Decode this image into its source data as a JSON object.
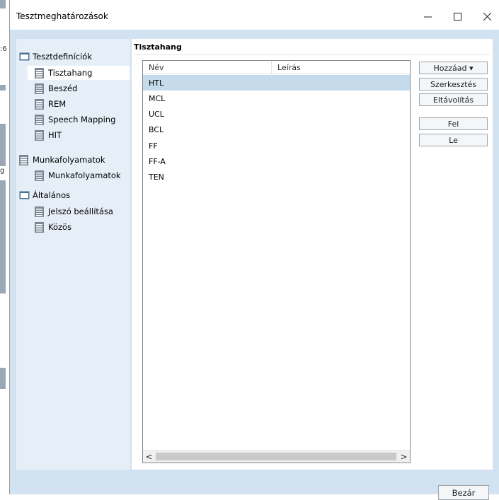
{
  "window": {
    "title": "Tesztmeghatározások",
    "controls": {
      "minimize": "minimize-icon",
      "maximize": "maximize-icon",
      "close": "close-icon"
    }
  },
  "background_fragments": [
    ":6",
    "g"
  ],
  "sidebar": {
    "items": [
      {
        "label": "Tesztdefiníciók",
        "icon": "folder-icon",
        "level": 0
      },
      {
        "label": "Tisztahang",
        "icon": "page-icon",
        "level": 1,
        "selected": true
      },
      {
        "label": "Beszéd",
        "icon": "page-icon",
        "level": 1
      },
      {
        "label": "REM",
        "icon": "page-icon",
        "level": 1
      },
      {
        "label": "Speech Mapping",
        "icon": "page-icon",
        "level": 1
      },
      {
        "label": "HIT",
        "icon": "page-icon",
        "level": 1
      },
      {
        "label": "Munkafolyamatok",
        "icon": "page-icon",
        "level": 0
      },
      {
        "label": "Munkafolyamatok",
        "icon": "page-icon",
        "level": 1
      },
      {
        "label": "Általános",
        "icon": "folder-icon",
        "level": 0
      },
      {
        "label": "Jelszó beállítása",
        "icon": "page-icon",
        "level": 1
      },
      {
        "label": "Közös",
        "icon": "page-icon",
        "level": 1
      }
    ]
  },
  "main": {
    "section_title": "Tisztahang",
    "table": {
      "columns": [
        "Név",
        "Leírás"
      ],
      "rows": [
        {
          "name": "HTL",
          "description": "",
          "selected": true
        },
        {
          "name": "MCL",
          "description": ""
        },
        {
          "name": "UCL",
          "description": ""
        },
        {
          "name": "BCL",
          "description": ""
        },
        {
          "name": "FF",
          "description": ""
        },
        {
          "name": "FF-A",
          "description": ""
        },
        {
          "name": "TEN",
          "description": ""
        }
      ],
      "scroll_left": "<",
      "scroll_right": ">"
    },
    "buttons": {
      "add": "Hozzáad ▾",
      "edit": "Szerkesztés",
      "remove": "Eltávolítás",
      "up": "Fel",
      "down": "Le"
    }
  },
  "footer": {
    "close_label": "Bezár"
  },
  "colors": {
    "client_background": "#d2e2f0",
    "nav_background": "#e6eff8",
    "selection": "#c5dbeb",
    "folder": "#4a6f93",
    "page_icon": "#7b8792"
  }
}
